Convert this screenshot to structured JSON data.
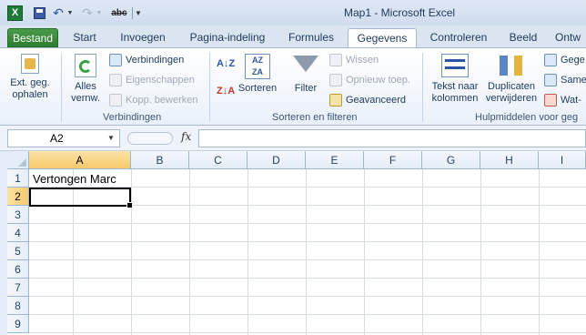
{
  "window": {
    "title": "Map1  -  Microsoft Excel"
  },
  "qat": {
    "spell_label": "abc"
  },
  "tabs": [
    {
      "label": "Bestand"
    },
    {
      "label": "Start"
    },
    {
      "label": "Invoegen"
    },
    {
      "label": "Pagina-indeling"
    },
    {
      "label": "Formules"
    },
    {
      "label": "Gegevens"
    },
    {
      "label": "Controleren"
    },
    {
      "label": "Beeld"
    },
    {
      "label": "Ontw"
    }
  ],
  "ribbon": {
    "get_external": {
      "line1": "Ext. geg.",
      "line2": "ophalen"
    },
    "refresh_all": {
      "line1": "Alles",
      "line2": "vernw."
    },
    "connections": "Verbindingen",
    "properties": "Eigenschappen",
    "edit_links": "Kopp. bewerken",
    "group_connections": "Verbindingen",
    "sort_label": "Sorteren",
    "filter_label": "Filter",
    "clear_label": "Wissen",
    "reapply_label": "Opnieuw toep.",
    "advanced_label": "Geavanceerd",
    "group_sort_filter": "Sorteren en filteren",
    "text_to_columns": {
      "line1": "Tekst naar",
      "line2": "kolommen"
    },
    "remove_duplicates": {
      "line1": "Duplicaten",
      "line2": "verwijderen"
    },
    "data_validation": "Gege",
    "consolidate": "Same",
    "what_if": "Wat-",
    "group_data_tools": "Hulpmiddelen voor geg"
  },
  "formula_bar": {
    "name_box": "A2",
    "fx_label": "fx",
    "content": ""
  },
  "sheet": {
    "columns": [
      "A",
      "B",
      "C",
      "D",
      "E",
      "F",
      "G",
      "H",
      "I"
    ],
    "rows": [
      "1",
      "2",
      "3",
      "4",
      "5",
      "6",
      "7",
      "8",
      "9"
    ],
    "cells": {
      "A1": "Vertongen Marc"
    },
    "selected": "A2"
  }
}
